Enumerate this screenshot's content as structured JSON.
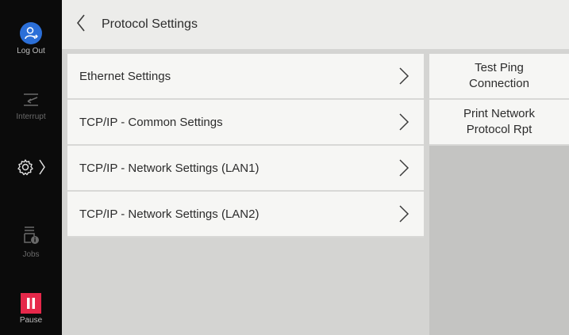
{
  "sidebar": {
    "logout_label": "Log Out",
    "interrupt_label": "Interrupt",
    "jobs_label": "Jobs",
    "pause_label": "Pause"
  },
  "header": {
    "title": "Protocol Settings"
  },
  "list": {
    "items": [
      {
        "label": "Ethernet Settings"
      },
      {
        "label": "TCP/IP - Common Settings"
      },
      {
        "label": "TCP/IP - Network Settings (LAN1)"
      },
      {
        "label": "TCP/IP - Network Settings (LAN2)"
      }
    ]
  },
  "actions": {
    "test_ping": {
      "line1": "Test Ping",
      "line2": "Connection"
    },
    "print_report": {
      "line1": "Print Network",
      "line2": "Protocol Rpt"
    }
  },
  "colors": {
    "sidebar_bg": "#0b0b0b",
    "logout_accent": "#2b6fd8",
    "pause_accent": "#e6284a"
  }
}
